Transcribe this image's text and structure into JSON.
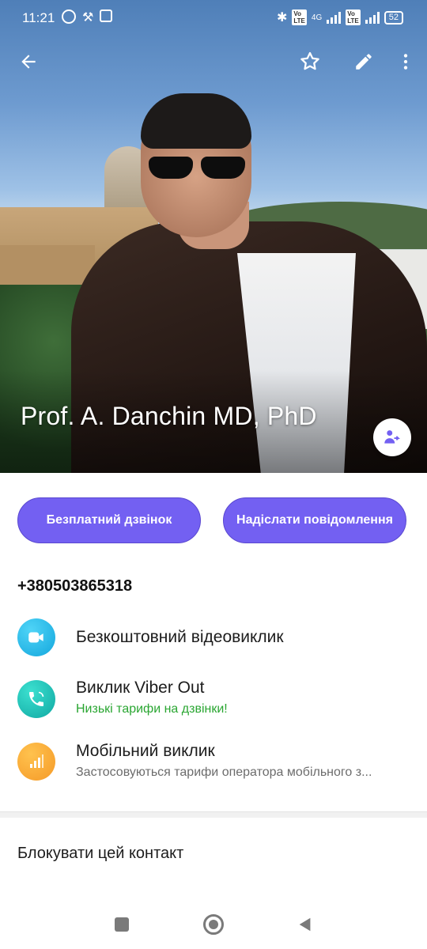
{
  "status_bar": {
    "time": "11:21",
    "network": "4G",
    "battery": "52"
  },
  "toolbar": {
    "back_icon": "arrow-left-icon",
    "favorite_icon": "star-icon",
    "edit_icon": "pencil-icon",
    "more_icon": "more-vertical-icon"
  },
  "contact": {
    "name": "Prof. A. Danchin MD, PhD",
    "phone": "+380503865318"
  },
  "actions": {
    "free_call_label": "Безплатний дзвінок",
    "send_message_label": "Надіслати повідомлення"
  },
  "call_options": [
    {
      "title": "Безкоштовний відеовиклик",
      "subtitle": "",
      "icon": "video-camera-icon",
      "color": "#1fb0e6"
    },
    {
      "title": "Виклик Viber Out",
      "subtitle": "Низькі тарифи на дзвінки!",
      "icon": "phone-icon",
      "color": "#17b5ab"
    },
    {
      "title": "Мобільний виклик",
      "subtitle": "Застосовуються тарифи оператора мобільного з...",
      "icon": "signal-bars-icon",
      "color": "#f6a031"
    }
  ],
  "block_contact_label": "Блокувати цей контакт",
  "colors": {
    "accent": "#7360f2",
    "viber_out_subtitle": "#2aa632"
  }
}
